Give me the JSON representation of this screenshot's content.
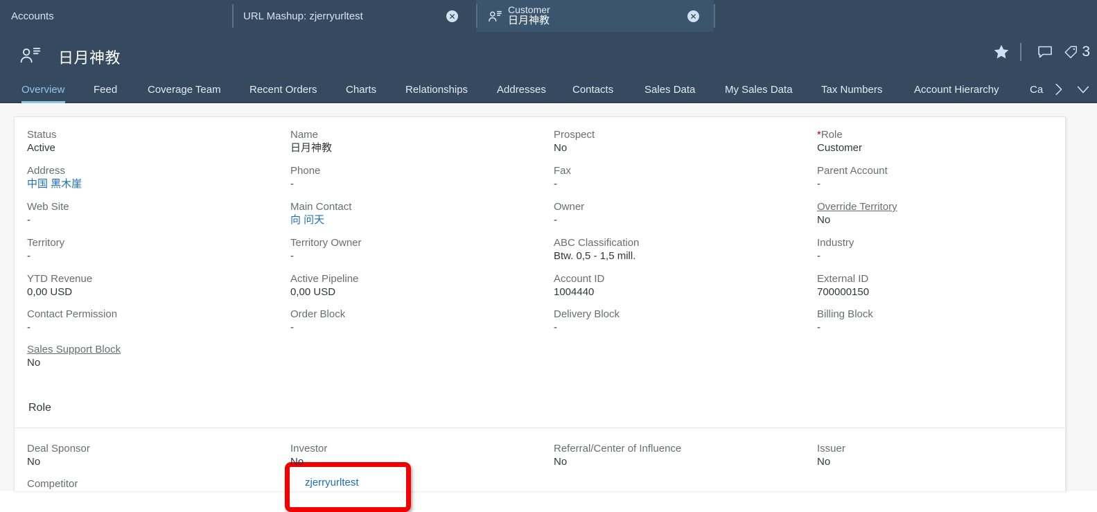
{
  "window": {
    "tabs": [
      {
        "id": "accounts",
        "label": "Accounts",
        "active": false,
        "closable": false,
        "icon": null
      },
      {
        "id": "urlmashup",
        "label": "URL Mashup: zjerryurltest",
        "active": false,
        "closable": true,
        "icon": null
      },
      {
        "id": "customer",
        "label_line1": "Customer",
        "label_line2": "日月神教",
        "active": true,
        "closable": true,
        "icon": "person-list-icon"
      }
    ]
  },
  "header": {
    "icon": "person-list-icon",
    "title": "日月神教",
    "actions": {
      "favorite": "star-icon",
      "comment": "speech-bubble-icon",
      "tag": "tag-icon",
      "tag_count": "3"
    }
  },
  "nav": {
    "tabs": [
      {
        "label": "Overview",
        "active": true
      },
      {
        "label": "Feed",
        "active": false
      },
      {
        "label": "Coverage Team",
        "active": false
      },
      {
        "label": "Recent Orders",
        "active": false
      },
      {
        "label": "Charts",
        "active": false
      },
      {
        "label": "Relationships",
        "active": false
      },
      {
        "label": "Addresses",
        "active": false
      },
      {
        "label": "Contacts",
        "active": false
      },
      {
        "label": "Sales Data",
        "active": false
      },
      {
        "label": "My Sales Data",
        "active": false
      },
      {
        "label": "Tax Numbers",
        "active": false
      },
      {
        "label": "Account Hierarchy",
        "active": false
      },
      {
        "label": "Ca",
        "active": false
      }
    ],
    "overflow_next": "chevron-right-icon",
    "overflow_more": "chevron-down-icon"
  },
  "overview": {
    "fields": [
      {
        "label": "Status",
        "value": "Active",
        "link_label": false,
        "link_value": false,
        "required": false
      },
      {
        "label": "Name",
        "value": "日月神教",
        "link_label": false,
        "link_value": false,
        "required": false
      },
      {
        "label": "Prospect",
        "value": "No",
        "link_label": false,
        "link_value": false,
        "required": false
      },
      {
        "label": "Role",
        "value": "Customer",
        "link_label": false,
        "link_value": false,
        "required": true
      },
      {
        "label": "Address",
        "value": "中国 黑木崖",
        "link_label": false,
        "link_value": true,
        "required": false
      },
      {
        "label": "Phone",
        "value": "-",
        "link_label": false,
        "link_value": false,
        "required": false
      },
      {
        "label": "Fax",
        "value": "-",
        "link_label": false,
        "link_value": false,
        "required": false
      },
      {
        "label": "Parent Account",
        "value": "-",
        "link_label": false,
        "link_value": false,
        "required": false
      },
      {
        "label": "Web Site",
        "value": "-",
        "link_label": false,
        "link_value": false,
        "required": false
      },
      {
        "label": "Main Contact",
        "value": "向 问天",
        "link_label": false,
        "link_value": true,
        "required": false
      },
      {
        "label": "Owner",
        "value": "-",
        "link_label": false,
        "link_value": false,
        "required": false
      },
      {
        "label": "Override Territory",
        "value": "No",
        "link_label": true,
        "link_value": false,
        "required": false
      },
      {
        "label": "Territory",
        "value": "-",
        "link_label": false,
        "link_value": false,
        "required": false
      },
      {
        "label": "Territory Owner",
        "value": "-",
        "link_label": false,
        "link_value": false,
        "required": false
      },
      {
        "label": "ABC Classification",
        "value": "Btw. 0,5 - 1,5 mill.",
        "link_label": false,
        "link_value": false,
        "required": false
      },
      {
        "label": "Industry",
        "value": "-",
        "link_label": false,
        "link_value": false,
        "required": false
      },
      {
        "label": "YTD Revenue",
        "value": "0,00  USD",
        "link_label": false,
        "link_value": false,
        "required": false
      },
      {
        "label": "Active Pipeline",
        "value": "0,00  USD",
        "link_label": false,
        "link_value": false,
        "required": false
      },
      {
        "label": "Account ID",
        "value": "1004440",
        "link_label": false,
        "link_value": false,
        "required": false
      },
      {
        "label": "External ID",
        "value": "700000150",
        "link_label": false,
        "link_value": false,
        "required": false
      },
      {
        "label": "Contact Permission",
        "value": "-",
        "link_label": false,
        "link_value": false,
        "required": false
      },
      {
        "label": "Order Block",
        "value": "-",
        "link_label": false,
        "link_value": false,
        "required": false
      },
      {
        "label": "Delivery Block",
        "value": "-",
        "link_label": false,
        "link_value": false,
        "required": false
      },
      {
        "label": "Billing Block",
        "value": "-",
        "link_label": false,
        "link_value": false,
        "required": false
      },
      {
        "label": "Sales Support Block",
        "value": "No",
        "link_label": true,
        "link_value": false,
        "required": false
      }
    ],
    "mashup_link": "zjerryurltest",
    "section_title": "Role",
    "role_section": {
      "fields": [
        {
          "label": "Deal Sponsor",
          "value": "No"
        },
        {
          "label": "Investor",
          "value": "No"
        },
        {
          "label": "Referral/Center of Influence",
          "value": "No"
        },
        {
          "label": "Issuer",
          "value": "No"
        }
      ],
      "next_label": "Competitor"
    }
  },
  "colors": {
    "chrome": "#354a5f",
    "chrome_active_tab": "#3c556e",
    "accent": "#8fc5ee",
    "link": "#1d6eb8",
    "label": "#6a6d70",
    "value": "#32363a",
    "highlight": "#f20000",
    "required": "#bb0000"
  }
}
